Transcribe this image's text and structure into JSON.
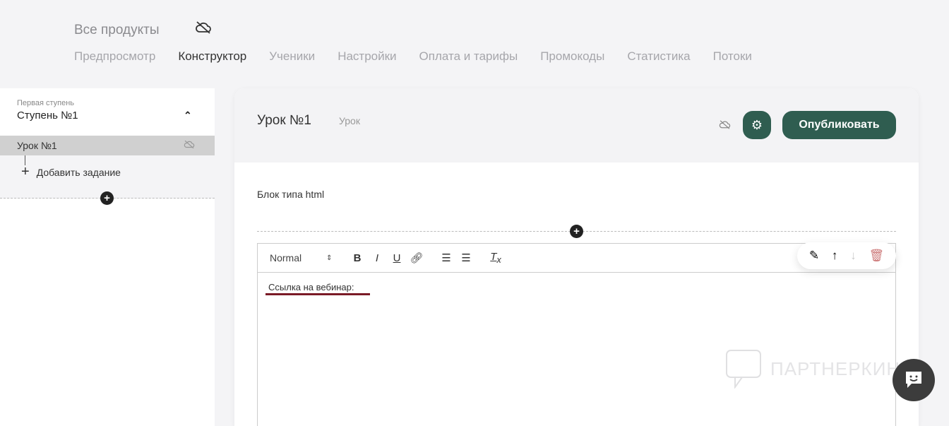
{
  "header": {
    "title": "Все продукты",
    "tabs": [
      "Предпросмотр",
      "Конструктор",
      "Ученики",
      "Настройки",
      "Оплата и тарифы",
      "Промокоды",
      "Статистика",
      "Потоки"
    ],
    "active_tab": "Конструктор"
  },
  "sidebar": {
    "step_subtitle": "Первая ступень",
    "step_title": "Ступень №1",
    "lesson": "Урок №1",
    "add_task": "Добавить задание"
  },
  "lesson": {
    "title": "Урок №1",
    "type": "Урок",
    "publish": "Опубликовать"
  },
  "content": {
    "block_label": "Блок типа html",
    "format": "Normal",
    "text": "Ссылка на вебинар:"
  },
  "watermark": "ПАРТНЕРКИН",
  "colors": {
    "primary": "#2f5d50",
    "chat": "#3c3c3c",
    "underline": "#7a1a26"
  }
}
